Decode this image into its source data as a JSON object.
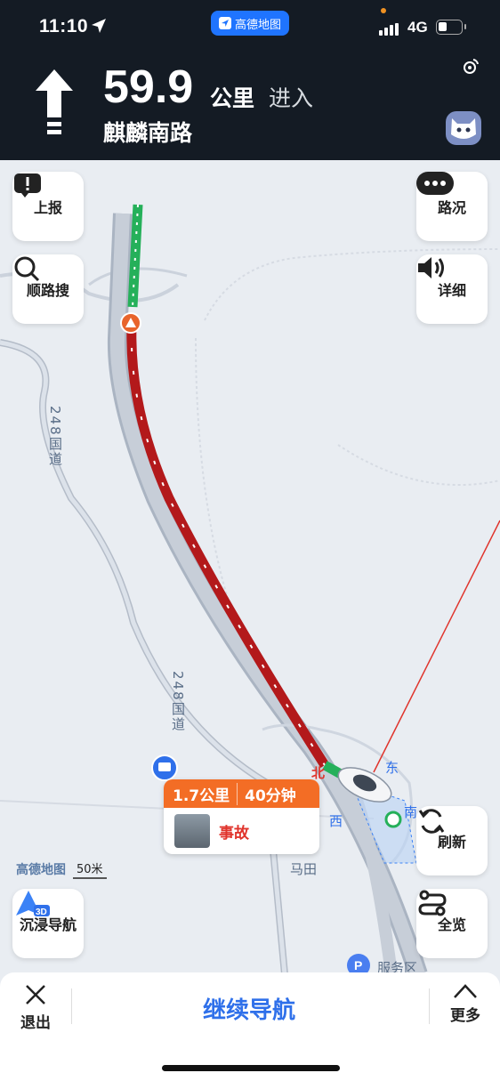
{
  "status_bar": {
    "time": "11:10",
    "network": "4G",
    "app_pill": "高德地图"
  },
  "guidance": {
    "distance": "59.9",
    "unit": "公里",
    "action": "进入",
    "road_name": "麒麟南路"
  },
  "buttons": {
    "report": "上报",
    "search_along": "顺路搜",
    "traffic": "路况",
    "detail": "详细",
    "refresh": "刷新",
    "overview": "全览",
    "immersive": "沉浸导航",
    "immersive_badge": "3D"
  },
  "incident": {
    "distance": "1.7公里",
    "duration": "40分钟",
    "type": "事故"
  },
  "scale": {
    "brand": "高德地图",
    "value": "50米"
  },
  "map_labels": {
    "road_248": "248国道",
    "road_248b": "248国道",
    "place": "马田",
    "north": "北",
    "east": "东",
    "south": "南",
    "west": "西",
    "service": "服务区"
  },
  "bottom": {
    "exit": "退出",
    "continue": "继续导航",
    "more": "更多"
  },
  "colors": {
    "accent": "#2f70ea",
    "congestion": "#b3191b",
    "clear": "#25b05a",
    "incident": "#f36d25"
  }
}
